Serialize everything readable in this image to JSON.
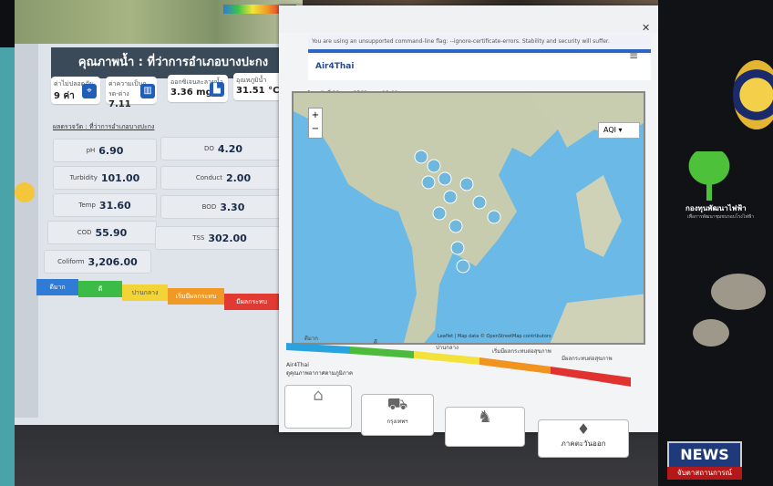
{
  "left_panel": {
    "title": "คุณภาพน้ำ : ที่ว่าการอำเภอบางปะกง",
    "stats": [
      {
        "label": "ค่าไม่ปลอดภัย",
        "value": "9 ค่า",
        "icon": "location-icon"
      },
      {
        "label": "ค่าความเป็นกรด-ด่าง",
        "value": "7.11",
        "icon": "beaker-icon"
      },
      {
        "label": "ออกซิเจนละลายน้ำ",
        "value": "3.36 mg/l",
        "icon": "factory-icon"
      },
      {
        "label": "อุณหภูมิน้ำ",
        "value": "31.51 °C",
        "icon": ""
      }
    ],
    "section_title": "ผลตรวจวัด : ที่ว่าการอำเภอบางปะกง",
    "params": [
      {
        "name": "pH",
        "value": "6.90"
      },
      {
        "name": "DO",
        "value": "4.20"
      },
      {
        "name": "Turbidity",
        "value": "101.00"
      },
      {
        "name": "Conduct",
        "value": "2.00"
      },
      {
        "name": "Temp",
        "value": "31.60"
      },
      {
        "name": "BOD",
        "value": "3.30"
      },
      {
        "name": "COD",
        "value": "55.90"
      },
      {
        "name": "TSS",
        "value": "302.00"
      },
      {
        "name": "Coliform",
        "value": "3,206.00"
      }
    ],
    "quality_scale": [
      {
        "label": "ดีมาก",
        "color": "#2f7bd6"
      },
      {
        "label": "ดี",
        "color": "#3cbb46"
      },
      {
        "label": "ปานกลาง",
        "color": "#f2d437"
      },
      {
        "label": "เริ่มมีผลกระทบ",
        "color": "#f09a25"
      },
      {
        "label": "มีผลกระทบ",
        "color": "#e23a32"
      }
    ]
  },
  "browser": {
    "warning": "You are using an unsupported command-line flag: --ignore-certificate-errors. Stability and security will suffer.",
    "app_name": "Air4Thai",
    "date_line": "ข้อมูลวันที่ 29 ส.ค. 2568 เวลา 13:00 น.",
    "map_select": "AQI",
    "map_attribution": "Leaflet | Map data © OpenStreetMap contributors",
    "aqi_scale": [
      {
        "label": "ดีมาก",
        "color": "#29a3e0"
      },
      {
        "label": "ดี",
        "color": "#4cbb3c"
      },
      {
        "label": "ปานกลาง",
        "color": "#f2e23a"
      },
      {
        "label": "เริ่มมีผลกระทบต่อสุขภาพ",
        "color": "#f0931f"
      },
      {
        "label": "มีผลกระทบต่อสุขภาพ",
        "color": "#e0322e"
      }
    ],
    "sidebar_title": "Air4Thai",
    "sidebar_sub": "ดูคุณภาพอากาศตามภูมิภาค",
    "region_cards": [
      {
        "label": "",
        "icon": "map-icon"
      },
      {
        "label": "กรุงเทพฯ",
        "icon": "tuktuk-icon"
      },
      {
        "label": "",
        "icon": "elephant-icon"
      },
      {
        "label": "ภาคตะวันออก",
        "icon": "lamp-icon"
      }
    ]
  },
  "right_display": {
    "org_name": "กองทุนพัฒนาไฟฟ้า",
    "org_sub": "เพื่อการพัฒนาชุมชนรอบโรงไฟฟ้า",
    "news_label": "NEWS",
    "news_sub": "จับตาสถานการณ์"
  }
}
